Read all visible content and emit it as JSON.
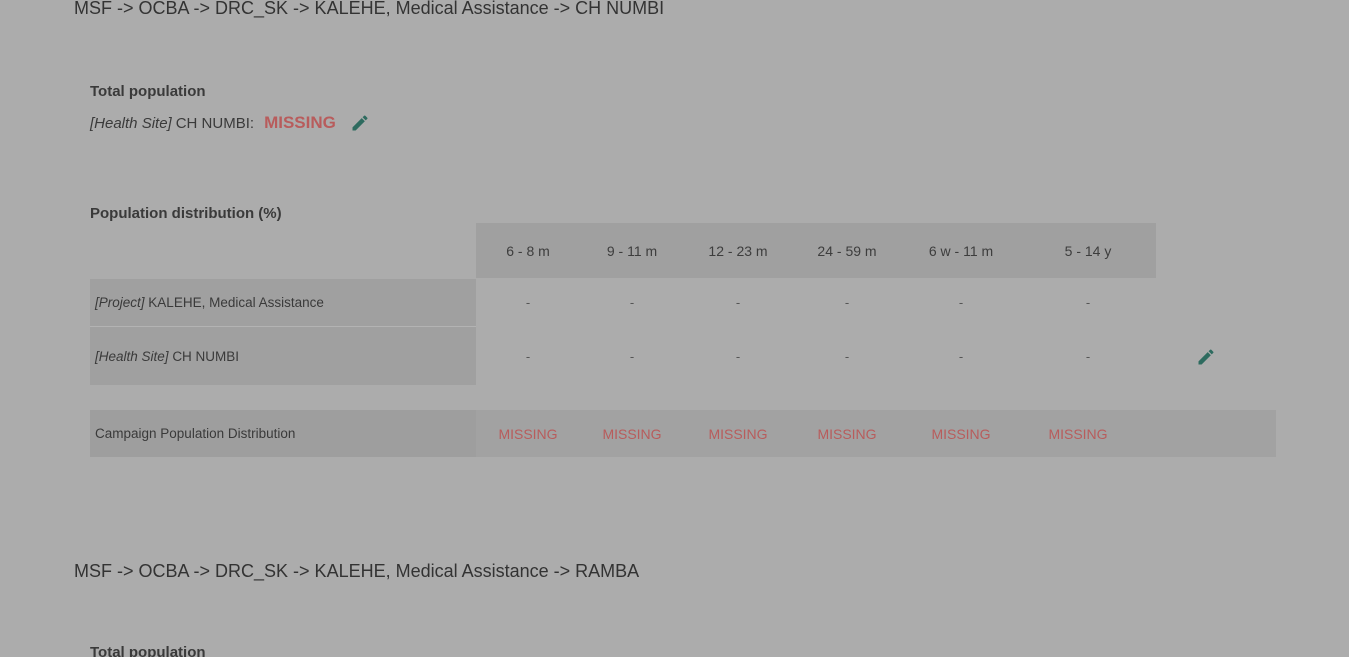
{
  "sections": [
    {
      "breadcrumb": "MSF -> OCBA -> DRC_SK -> KALEHE, Medical Assistance -> CH NUMBI",
      "total_population": {
        "heading": "Total population",
        "site_tag": "[Health Site]",
        "site_name": "CH NUMBI:",
        "value": "MISSING"
      },
      "distribution": {
        "heading": "Population distribution (%)",
        "columns": [
          "6 - 8 m",
          "9 - 11 m",
          "12 - 23 m",
          "24 - 59 m",
          "6 w - 11 m",
          "5 - 14 y"
        ],
        "rows": [
          {
            "tag": "[Project]",
            "name": "KALEHE, Medical Assistance",
            "values": [
              "-",
              "-",
              "-",
              "-",
              "-",
              "-"
            ]
          },
          {
            "tag": "[Health Site]",
            "name": "CH NUMBI",
            "values": [
              "-",
              "-",
              "-",
              "-",
              "-",
              "-"
            ]
          }
        ],
        "campaign": {
          "label": "Campaign Population Distribution",
          "values": [
            "MISSING",
            "MISSING",
            "MISSING",
            "MISSING",
            "MISSING",
            "MISSING"
          ]
        }
      }
    },
    {
      "breadcrumb": "MSF -> OCBA -> DRC_SK -> KALEHE, Medical Assistance -> RAMBA",
      "total_population": {
        "heading": "Total population"
      }
    }
  ],
  "colors": {
    "missing": "#b85c5c",
    "edit_icon": "#2e6b5f"
  }
}
